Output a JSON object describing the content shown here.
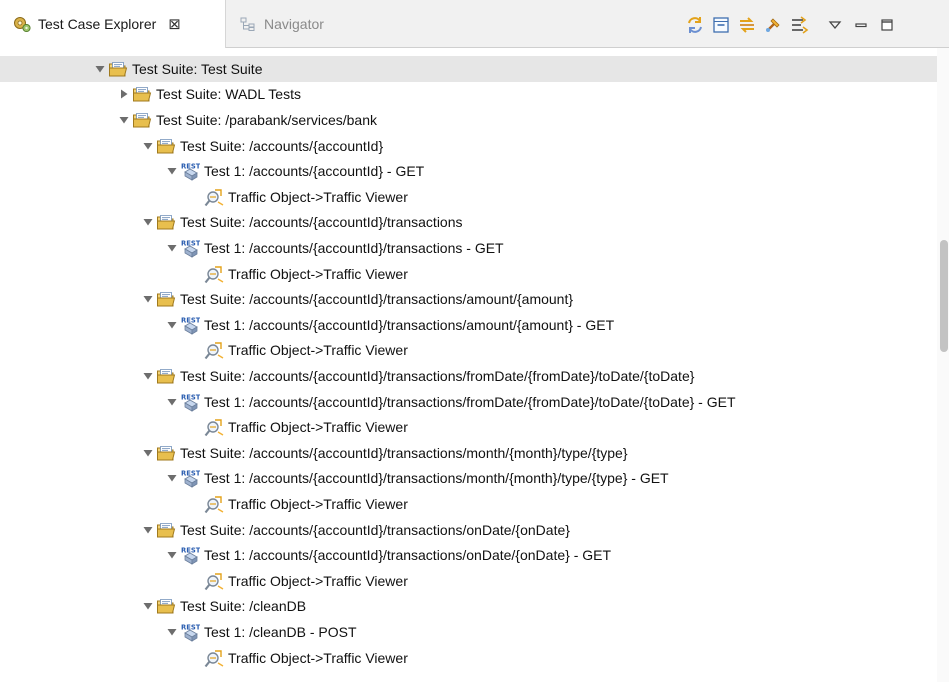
{
  "tabs": [
    {
      "label": "Test Case Explorer",
      "active": true,
      "close": "⊠"
    },
    {
      "label": "Navigator",
      "active": false
    }
  ],
  "toolbar": {
    "icons": [
      "sync-icon",
      "collapse-all-icon",
      "link-with-editor-icon",
      "run-icon",
      "filter-icon",
      "view-menu-icon",
      "minimize-icon",
      "maximize-icon"
    ]
  },
  "colors": {
    "folder": "#e8c25a",
    "rest_badge": "#2a5db0",
    "selection": "#e6e6e6",
    "tab_bg": "#f1f1f1"
  },
  "tree": [
    {
      "level": 0,
      "type": "suite",
      "expanded": true,
      "selected": true,
      "label": "Test Suite: Test Suite"
    },
    {
      "level": 1,
      "type": "suite",
      "expanded": false,
      "label": "Test Suite: WADL Tests"
    },
    {
      "level": 1,
      "type": "suite",
      "expanded": true,
      "label": "Test Suite: /parabank/services/bank"
    },
    {
      "level": 2,
      "type": "suite",
      "expanded": true,
      "label": "Test Suite: /accounts/{accountId}"
    },
    {
      "level": 3,
      "type": "rest",
      "expanded": true,
      "label": "Test 1: /accounts/{accountId} - GET"
    },
    {
      "level": 4,
      "type": "traffic",
      "label": "Traffic Object->Traffic Viewer"
    },
    {
      "level": 2,
      "type": "suite",
      "expanded": true,
      "label": "Test Suite: /accounts/{accountId}/transactions"
    },
    {
      "level": 3,
      "type": "rest",
      "expanded": true,
      "label": "Test 1: /accounts/{accountId}/transactions - GET"
    },
    {
      "level": 4,
      "type": "traffic",
      "label": "Traffic Object->Traffic Viewer"
    },
    {
      "level": 2,
      "type": "suite",
      "expanded": true,
      "label": "Test Suite: /accounts/{accountId}/transactions/amount/{amount}"
    },
    {
      "level": 3,
      "type": "rest",
      "expanded": true,
      "label": "Test 1: /accounts/{accountId}/transactions/amount/{amount} - GET"
    },
    {
      "level": 4,
      "type": "traffic",
      "label": "Traffic Object->Traffic Viewer"
    },
    {
      "level": 2,
      "type": "suite",
      "expanded": true,
      "label": "Test Suite: /accounts/{accountId}/transactions/fromDate/{fromDate}/toDate/{toDate}"
    },
    {
      "level": 3,
      "type": "rest",
      "expanded": true,
      "label": "Test 1: /accounts/{accountId}/transactions/fromDate/{fromDate}/toDate/{toDate} - GET"
    },
    {
      "level": 4,
      "type": "traffic",
      "label": "Traffic Object->Traffic Viewer"
    },
    {
      "level": 2,
      "type": "suite",
      "expanded": true,
      "label": "Test Suite: /accounts/{accountId}/transactions/month/{month}/type/{type}"
    },
    {
      "level": 3,
      "type": "rest",
      "expanded": true,
      "label": "Test 1: /accounts/{accountId}/transactions/month/{month}/type/{type} - GET"
    },
    {
      "level": 4,
      "type": "traffic",
      "label": "Traffic Object->Traffic Viewer"
    },
    {
      "level": 2,
      "type": "suite",
      "expanded": true,
      "label": "Test Suite: /accounts/{accountId}/transactions/onDate/{onDate}"
    },
    {
      "level": 3,
      "type": "rest",
      "expanded": true,
      "label": "Test 1: /accounts/{accountId}/transactions/onDate/{onDate} - GET"
    },
    {
      "level": 4,
      "type": "traffic",
      "label": "Traffic Object->Traffic Viewer"
    },
    {
      "level": 2,
      "type": "suite",
      "expanded": true,
      "label": "Test Suite: /cleanDB"
    },
    {
      "level": 3,
      "type": "rest",
      "expanded": true,
      "label": "Test 1: /cleanDB - POST"
    },
    {
      "level": 4,
      "type": "traffic",
      "label": "Traffic Object->Traffic Viewer"
    }
  ]
}
